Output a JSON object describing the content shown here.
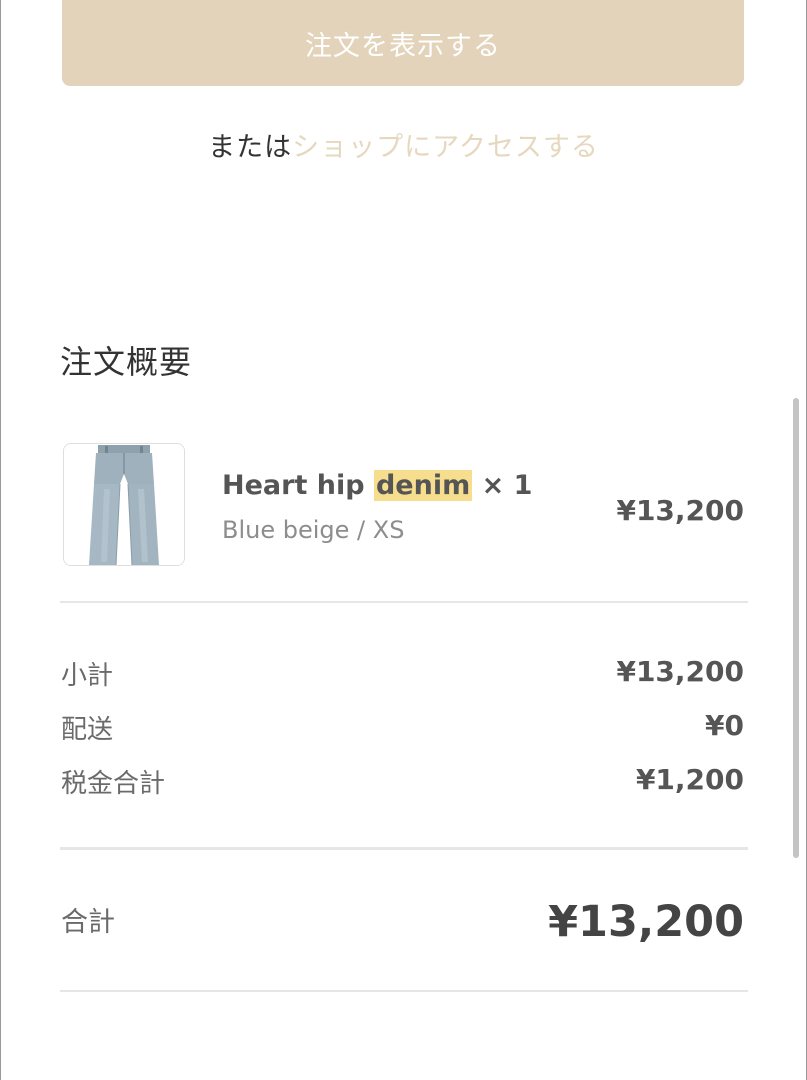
{
  "actions": {
    "view_order_label": "注文を表示する",
    "or_text": "または",
    "shop_link": "ショップにアクセスする"
  },
  "summary": {
    "title": "注文概要",
    "item": {
      "name": "Heart hip ",
      "name_highlight": "denim",
      "quantity": " × 1",
      "variant": "Blue beige / XS",
      "price": "¥13,200",
      "image_icon": "denim-jeans-image"
    },
    "costs": [
      {
        "label": "小計",
        "value": "¥13,200"
      },
      {
        "label": "配送",
        "value": "¥0"
      },
      {
        "label": "税金合計",
        "value": "¥1,200"
      }
    ],
    "total": {
      "label": "合計",
      "value": "¥13,200"
    }
  },
  "colors": {
    "button_bg": "#e2d3ba",
    "link": "#e6d8bf",
    "highlight": "#f7de8e"
  }
}
